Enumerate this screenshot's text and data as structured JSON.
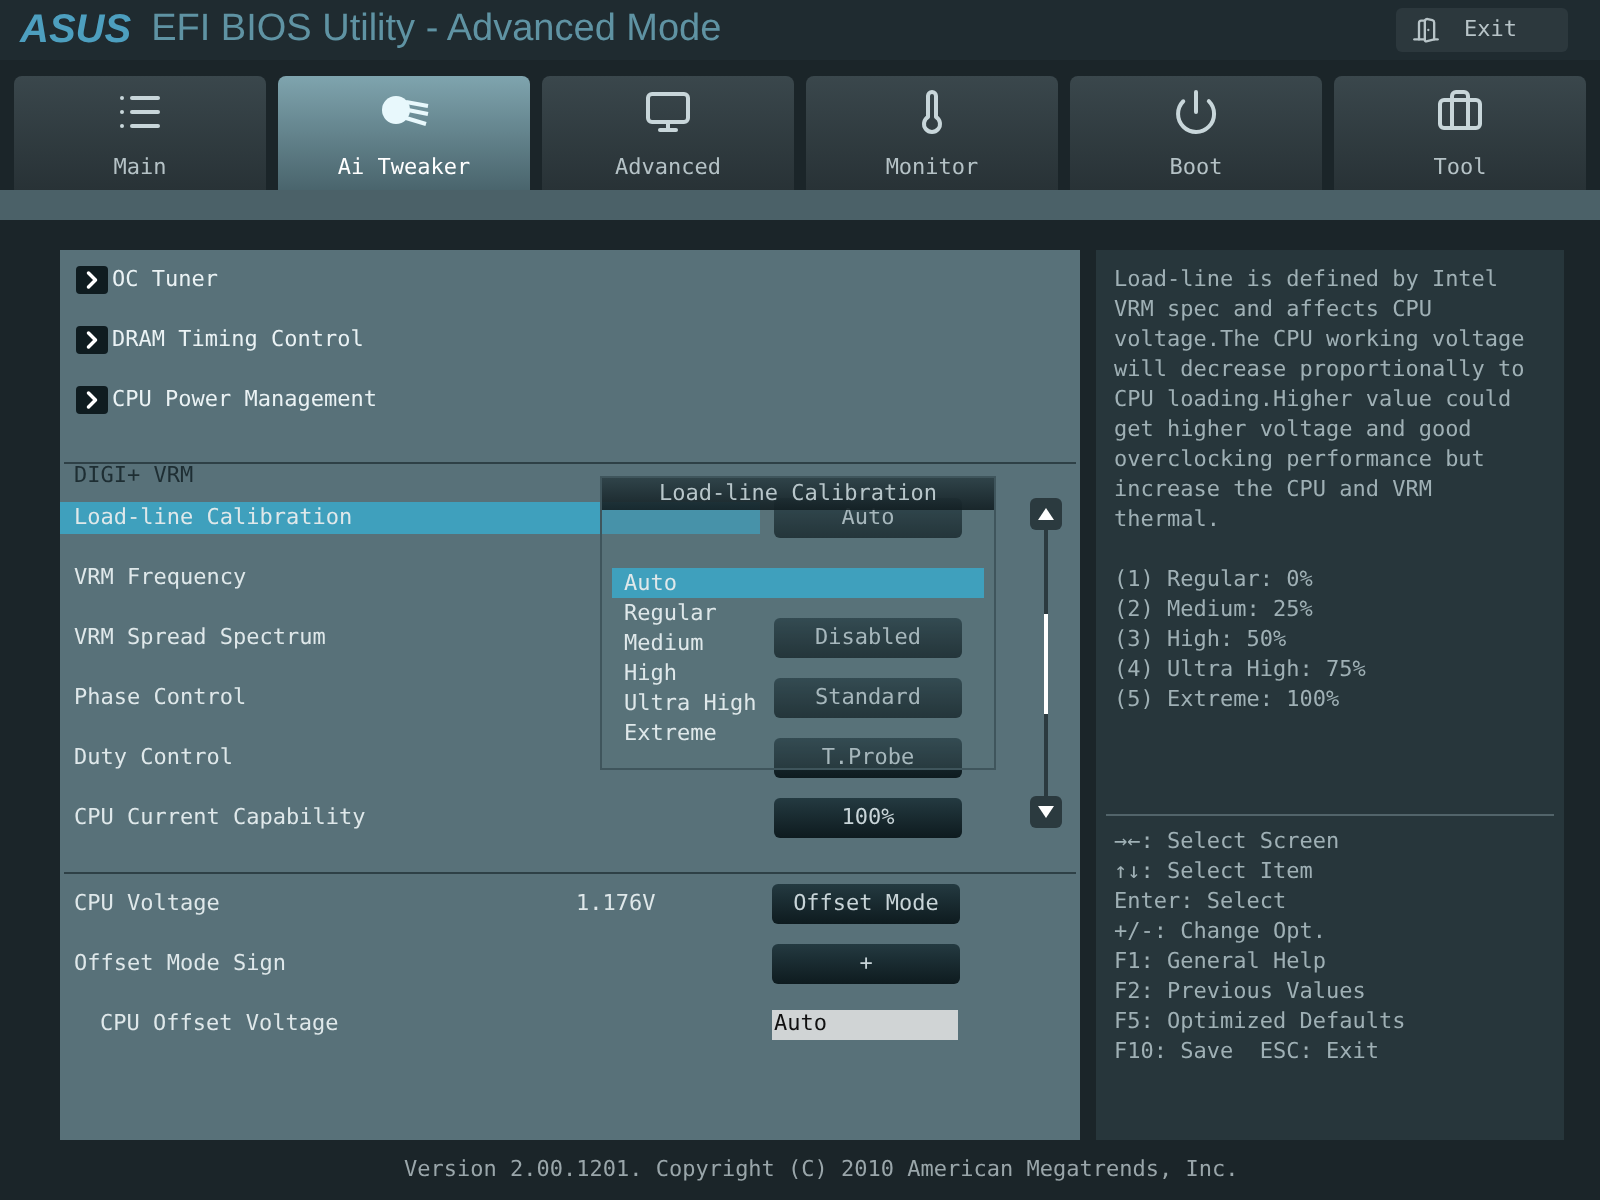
{
  "header": {
    "logo": "ASUS",
    "title": "EFI BIOS Utility - Advanced Mode",
    "exit": "Exit"
  },
  "tabs": [
    {
      "label": "Main",
      "selected": false,
      "kind": "list"
    },
    {
      "label": "Ai Tweaker",
      "selected": true,
      "kind": "comet"
    },
    {
      "label": "Advanced",
      "selected": false,
      "kind": "monitor"
    },
    {
      "label": "Monitor",
      "selected": false,
      "kind": "thermometer"
    },
    {
      "label": "Boot",
      "selected": false,
      "kind": "power"
    },
    {
      "label": "Tool",
      "selected": false,
      "kind": "toolbox"
    }
  ],
  "submenus": [
    "OC Tuner",
    "DRAM Timing Control",
    "CPU Power Management"
  ],
  "section_label": "DIGI+ VRM",
  "settings": [
    {
      "label": "Load-line Calibration",
      "selected": true,
      "value": "Auto"
    },
    {
      "label": "VRM Frequency",
      "selected": false
    },
    {
      "label": "VRM Spread Spectrum",
      "selected": false,
      "value": "Disabled"
    },
    {
      "label": "Phase Control",
      "selected": false,
      "value": "Standard"
    },
    {
      "label": "Duty Control",
      "selected": false,
      "value": "T.Probe"
    },
    {
      "label": "CPU Current Capability",
      "selected": false,
      "value": "100%"
    }
  ],
  "voltage_settings": [
    {
      "label": "CPU Voltage",
      "reading": "1.176V",
      "value": "Offset Mode",
      "kind": "button"
    },
    {
      "label": "Offset Mode Sign",
      "value": "+",
      "kind": "button"
    },
    {
      "label": "CPU Offset Voltage",
      "value": "Auto",
      "kind": "field"
    }
  ],
  "popup": {
    "title": "Load-line Calibration",
    "options": [
      {
        "label": "Auto",
        "selected": true
      },
      {
        "label": "Regular",
        "selected": false
      },
      {
        "label": "Medium",
        "selected": false
      },
      {
        "label": "High",
        "selected": false
      },
      {
        "label": "Ultra High",
        "selected": false
      },
      {
        "label": "Extreme",
        "selected": false
      }
    ]
  },
  "help": {
    "description": "Load-line is defined by Intel VRM spec and affects CPU voltage.The CPU working voltage will decrease proportionally to CPU loading.Higher value could get higher voltage and good overclocking performance but increase the CPU and VRM thermal.",
    "levels": [
      "(1) Regular: 0%",
      "(2) Medium: 25%",
      "(3) High: 50%",
      "(4) Ultra High: 75%",
      "(5) Extreme: 100%"
    ],
    "keys": [
      "→←: Select Screen",
      "↑↓: Select Item",
      "Enter: Select",
      "+/-: Change Opt.",
      "F1: General Help",
      "F2: Previous Values",
      "F5: Optimized Defaults",
      "F10: Save  ESC: Exit"
    ]
  },
  "footer": "Version 2.00.1201. Copyright (C) 2010 American Megatrends, Inc."
}
